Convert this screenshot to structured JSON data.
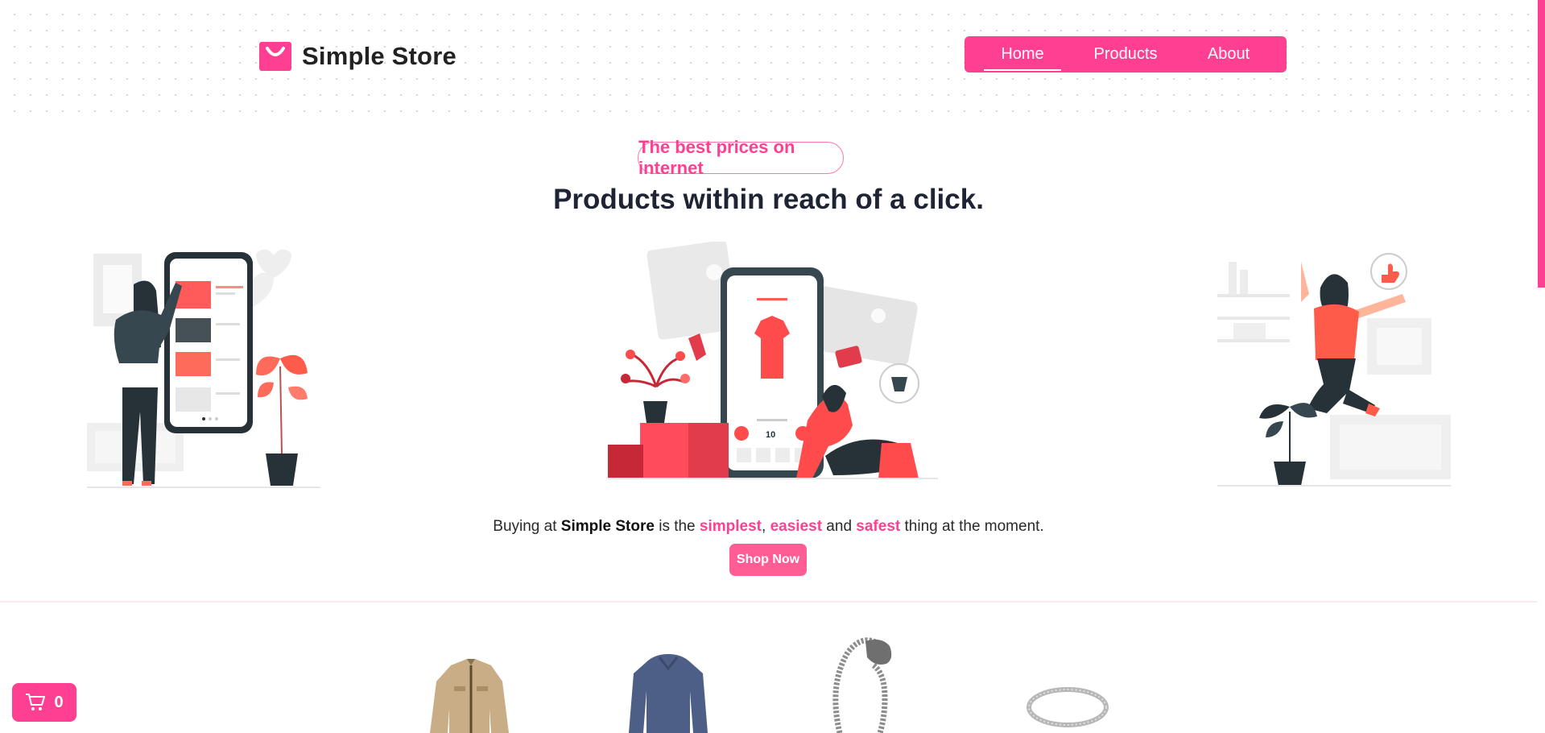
{
  "header": {
    "brand_name": "Simple Store",
    "nav": [
      {
        "label": "Home",
        "active": true
      },
      {
        "label": "Products",
        "active": false
      },
      {
        "label": "About",
        "active": false
      }
    ]
  },
  "hero": {
    "badge": "The best prices on internet",
    "headline": "Products within reach of a click.",
    "tagline": {
      "prefix": "Buying at ",
      "brand": "Simple Store",
      "middle": " is the ",
      "word1": "simplest",
      "comma": ", ",
      "word2": "easiest",
      "and": " and ",
      "word3": "safest",
      "suffix": " thing at the moment."
    },
    "cta_label": "Shop Now",
    "illustration_phone_price": "10"
  },
  "cart": {
    "count": "0",
    "icon": "cart-icon"
  },
  "colors": {
    "accent": "#ff3f91",
    "accent_soft": "#ff5d94",
    "text_dark": "#1e2433"
  }
}
